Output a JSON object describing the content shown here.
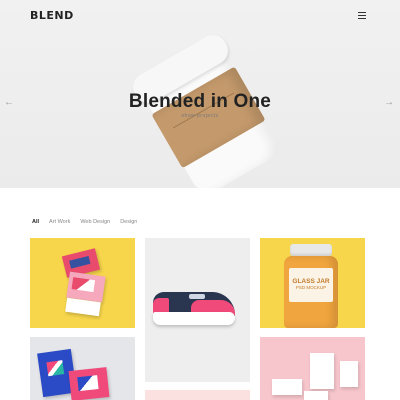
{
  "header": {
    "logo": "BLEND",
    "menu_icon": "hamburger-menu-icon"
  },
  "hero": {
    "title": "Blended in One",
    "subtitle": "show projects",
    "prev_arrow": "←",
    "next_arrow": "→"
  },
  "filters": [
    {
      "label": "All",
      "active": true
    },
    {
      "label": "Art Work",
      "active": false
    },
    {
      "label": "Web Design",
      "active": false
    },
    {
      "label": "Design",
      "active": false
    }
  ],
  "portfolio": {
    "tiles": [
      {
        "name": "business-cards",
        "background": "#f7d64c"
      },
      {
        "name": "sneaker",
        "background": "#eeeeee"
      },
      {
        "name": "jar-mockup",
        "background": "#f7d64c",
        "label_line1": "GLASS JAR",
        "label_line2": "PSD MOCKUP"
      },
      {
        "name": "branding-cards",
        "background": "#e4e6ea"
      },
      {
        "name": "pink-tile",
        "background": "#fbe1df"
      },
      {
        "name": "stationery",
        "background": "#f6c6cc"
      }
    ]
  },
  "colors": {
    "accent_pink": "#f04a7a",
    "accent_yellow": "#f7d64c",
    "text_dark": "#222222"
  }
}
